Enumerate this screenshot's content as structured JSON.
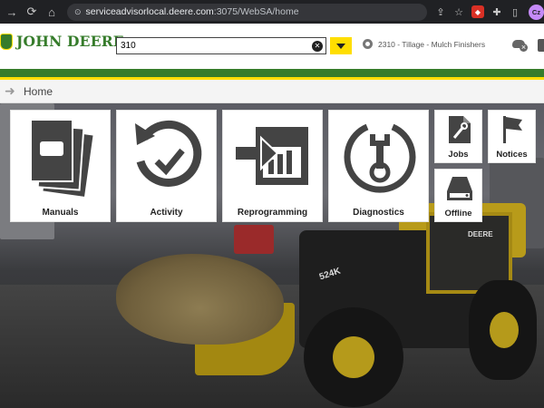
{
  "browser": {
    "url_host": "serviceadvisorlocal.deere.com",
    "url_path": ":3075/WebSA/home",
    "profile_initials": "Cz"
  },
  "header": {
    "brand": "JOHN DEERE",
    "search_value": "310",
    "machine_label": "2310 - Tillage - Mulch Finishers"
  },
  "breadcrumb": {
    "current": "Home"
  },
  "tiles": {
    "manuals": "Manuals",
    "activity": "Activity",
    "reprogramming": "Reprogramming",
    "diagnostics": "Diagnostics",
    "jobs": "Jobs",
    "notices": "Notices",
    "offline": "Offline"
  },
  "hero": {
    "model_tag": "524K",
    "deere_tag": "DEERE"
  },
  "colors": {
    "brand_green": "#367c2b",
    "brand_yellow": "#ffde00",
    "icon_dark": "#444444"
  }
}
